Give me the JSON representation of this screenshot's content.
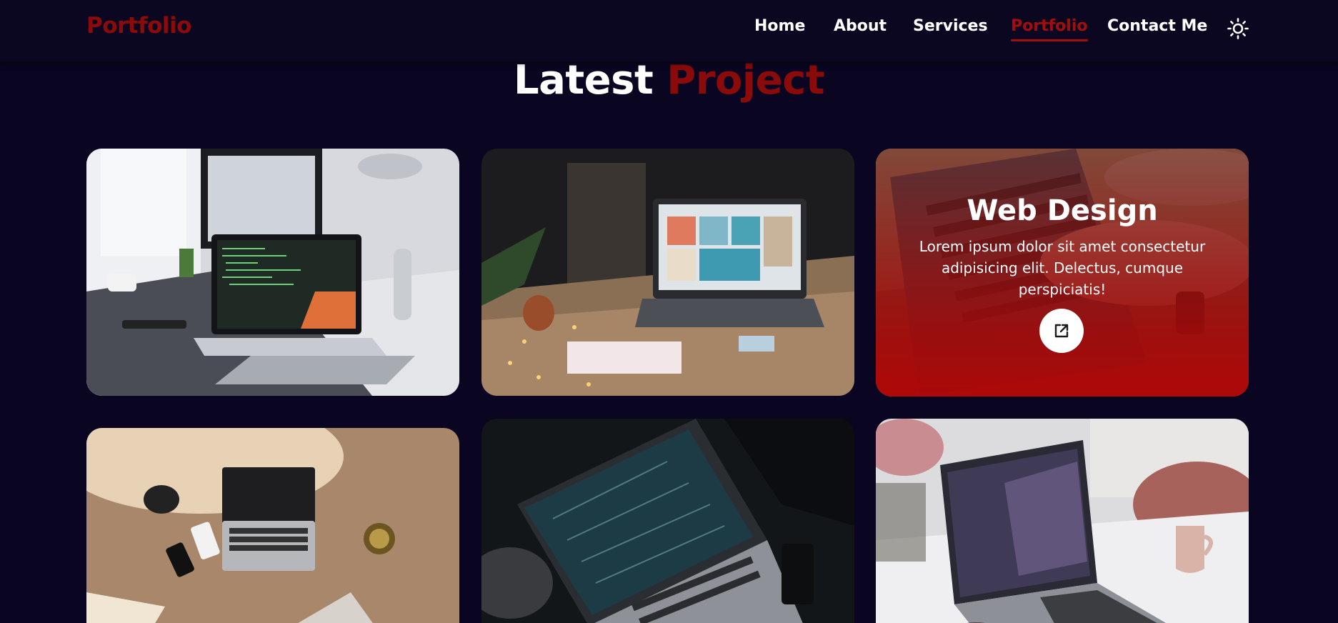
{
  "header": {
    "logo": "Portfolio",
    "nav": [
      {
        "label": "Home",
        "active": false
      },
      {
        "label": "About",
        "active": false
      },
      {
        "label": "Services",
        "active": false
      },
      {
        "label": "Portfolio",
        "active": true
      },
      {
        "label": "Contact Me",
        "active": false
      }
    ],
    "theme_icon": "sun-icon"
  },
  "section": {
    "title_main": "Latest",
    "title_accent": "Project"
  },
  "projects": [
    {
      "photo": "laptop-code-desk",
      "hovered": false
    },
    {
      "photo": "laptop-table-lights",
      "hovered": false
    },
    {
      "photo": "laptop-typing-hands",
      "hovered": true,
      "title": "Web Design",
      "description": "Lorem ipsum dolor sit amet consectetur adipisicing elit. Delectus, cumque perspiciatis!",
      "link_icon": "external-link-icon"
    },
    {
      "photo": "laptop-flatlay-desk",
      "hovered": false
    },
    {
      "photo": "laptop-car-seat",
      "hovered": false
    },
    {
      "photo": "laptop-marble-table",
      "hovered": false
    }
  ],
  "colors": {
    "background": "#0a0520",
    "accent": "#8b0a0a",
    "text": "#ffffff"
  }
}
